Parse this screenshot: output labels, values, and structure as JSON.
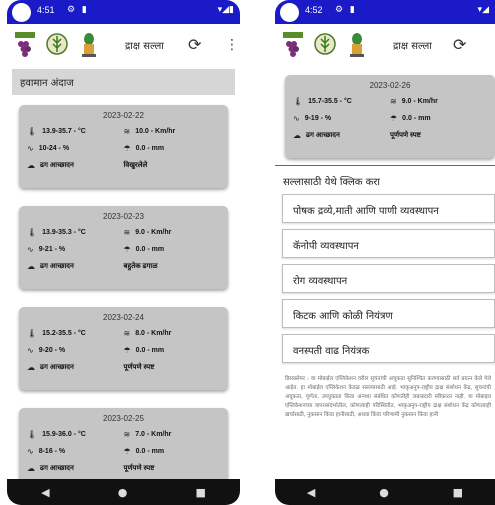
{
  "left": {
    "status": {
      "time": "4:51",
      "icons": "⚙ ▮",
      "right": "▾◢▮"
    },
    "appbar": {
      "title": "द्राक्ष सल्ला",
      "refresh": "⟳",
      "more": "⋮"
    },
    "section_title": "हवामान अंदाज",
    "cards": [
      {
        "date": "2023-02-22",
        "temp": "13.9-35.7 - °C",
        "wind": "10.0 - Km/hr",
        "humidity": "10-24 - %",
        "rain": "0.0 - mm",
        "cloud_label": "ढग आच्छादन",
        "cloud_value": "विखुरलेले"
      },
      {
        "date": "2023-02-23",
        "temp": "13.9-35.3 - °C",
        "wind": "9.0 - Km/hr",
        "humidity": "9-21 - %",
        "rain": "0.0 - mm",
        "cloud_label": "ढग आच्छादन",
        "cloud_value": "बहुतेक ढगाळ"
      },
      {
        "date": "2023-02-24",
        "temp": "15.2-35.5 - °C",
        "wind": "8.0 - Km/hr",
        "humidity": "9-20 - %",
        "rain": "0.0 - mm",
        "cloud_label": "ढग आच्छादन",
        "cloud_value": "पूर्णपणे स्पष्ट"
      },
      {
        "date": "2023-02-25",
        "temp": "15.9-36.0 - °C",
        "wind": "7.0 - Km/hr",
        "humidity": "8-16 - %",
        "rain": "0.0 - mm",
        "cloud_label": "ढग आच्छादन",
        "cloud_value": "पूर्णपणे स्पष्ट"
      }
    ]
  },
  "right": {
    "status": {
      "time": "4:52",
      "icons": "⚙ ▮",
      "right": "▾◢"
    },
    "appbar": {
      "title": "द्राक्ष सल्ला",
      "refresh": "⟳",
      "more": "⋮"
    },
    "card": {
      "date": "2023-02-26",
      "temp": "15.7-35.5 - °C",
      "wind": "9.0 - Km/hr",
      "humidity": "9-19 - %",
      "rain": "0.0 - mm",
      "cloud_label": "ढग आच्छादन",
      "cloud_value": "पूर्णपणे स्पष्ट"
    },
    "menu_title": "सल्लासाठी येथे क्लिक करा",
    "menu_items": [
      "पोषक द्रव्ये,माती आणि पाणी व्यवस्थापन",
      "कॅनोपी व्यवस्थापन",
      "रोग व्यवस्थापन",
      "किटक आणि कोळी नियंत्रण",
      "वनस्पती वाढ नियंत्रक"
    ],
    "disclaimer": "डिसक्लेमर : या मोबाईल एप्लिकेशन वरील सूचनांची अचूकता सुनिश्चित करण्यासाठी सर्व प्रयत्न केले गेले आहेत. हा मोबाईल एप्लिकेशन केवळ सल्ल्यासाठी आहे. भाकृअनुप-राष्ट्रीय द्राक्ष संशोधन केंद्र, सूचनांची अचूकता, पूर्णता, उपयुक्तता किंवा अन्यथा संबंधित कोणतीही जबाबदारी स्वीकारत नाही. या मोबाइल एप्लिकेशनच्या वापरासंदर्भातील, कोणत्याही परिस्थितीत, भाकृअनुप-राष्ट्रीय द्राक्ष संशोधन केंद्र कोणत्याही खर्चासाठी, नुकसान किंवा हानीसाठी, अथवा किंवा परिणामी नुकसान किंवा हानी"
  },
  "nav": {
    "back": "◀",
    "home": "●",
    "recents": "■"
  },
  "icons": {
    "temp": "🌡",
    "wind": "≋",
    "humidity": "∿",
    "rain": "☂",
    "cloud": "☁"
  },
  "colors": {
    "statusbar": "#1a1ac9",
    "card": "#c5c5c5",
    "section": "#d6d6d6"
  }
}
